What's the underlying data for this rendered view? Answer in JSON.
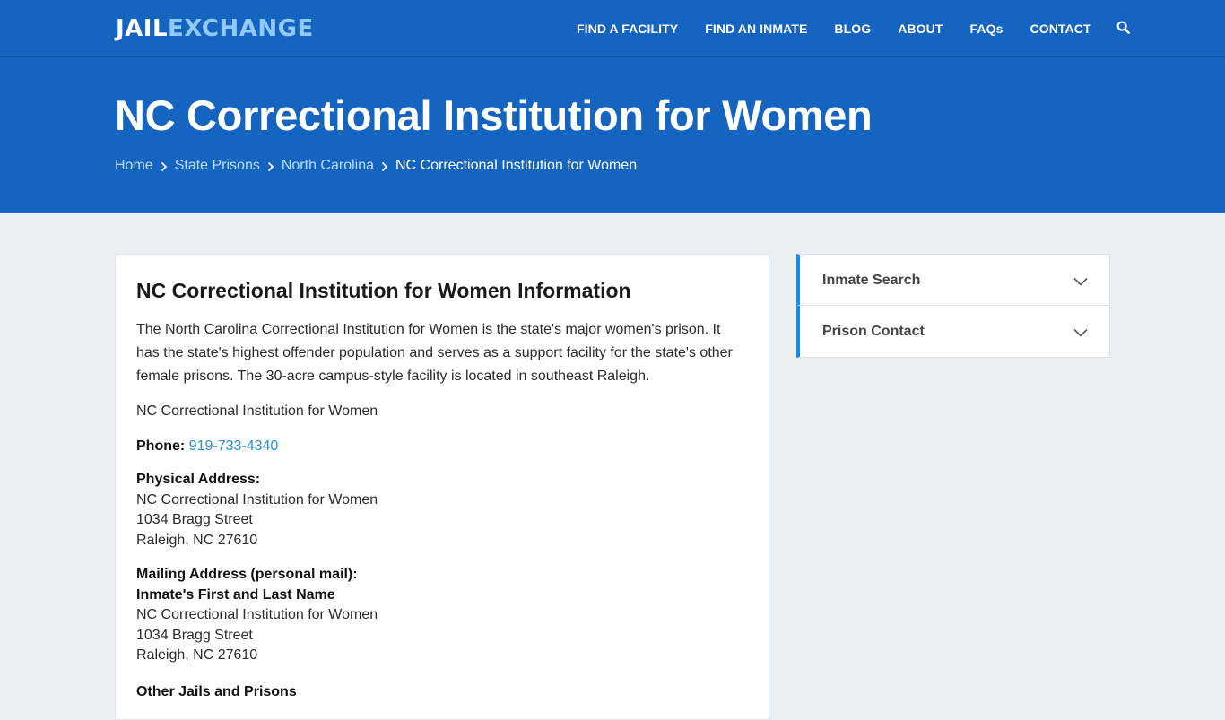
{
  "header": {
    "logo_part1": "JAIL",
    "logo_part2": "EXCHANGE",
    "nav": [
      {
        "label": "FIND A FACILITY"
      },
      {
        "label": "FIND AN INMATE"
      },
      {
        "label": "BLOG"
      },
      {
        "label": "ABOUT"
      },
      {
        "label": "FAQs"
      },
      {
        "label": "CONTACT"
      }
    ],
    "search_icon": "search-icon"
  },
  "hero": {
    "title": "NC Correctional Institution for Women",
    "breadcrumb": [
      {
        "label": "Home"
      },
      {
        "label": "State Prisons"
      },
      {
        "label": "North Carolina"
      },
      {
        "label": "NC Correctional Institution for Women"
      }
    ]
  },
  "main": {
    "heading": "NC Correctional Institution for Women Information",
    "intro": "The North Carolina Correctional Institution for Women is the state's major women's prison. It has the state's highest offender population and serves as a support facility for the state's other female prisons. The 30-acre campus-style facility is located in southeast Raleigh.",
    "facility_name": "NC Correctional Institution for Women",
    "phone_label": "Phone:",
    "phone": "919-733-4340",
    "physical": {
      "label": "Physical Address:",
      "line1": "NC Correctional Institution for Women",
      "line2": "1034 Bragg Street",
      "line3": "Raleigh, NC 27610"
    },
    "mailing": {
      "label": "Mailing Address (personal mail):",
      "name_line": "Inmate's First and Last Name",
      "line1": "NC Correctional Institution for Women",
      "line2": "1034 Bragg Street",
      "line3": "Raleigh, NC 27610"
    },
    "other_heading": "Other Jails and Prisons"
  },
  "sidebar": {
    "items": [
      {
        "label": "Inmate Search"
      },
      {
        "label": "Prison Contact"
      }
    ]
  },
  "colors": {
    "brand_blue": "#1565c0",
    "accent_blue": "#1e88e5",
    "link_blue": "#2b8ed6"
  }
}
